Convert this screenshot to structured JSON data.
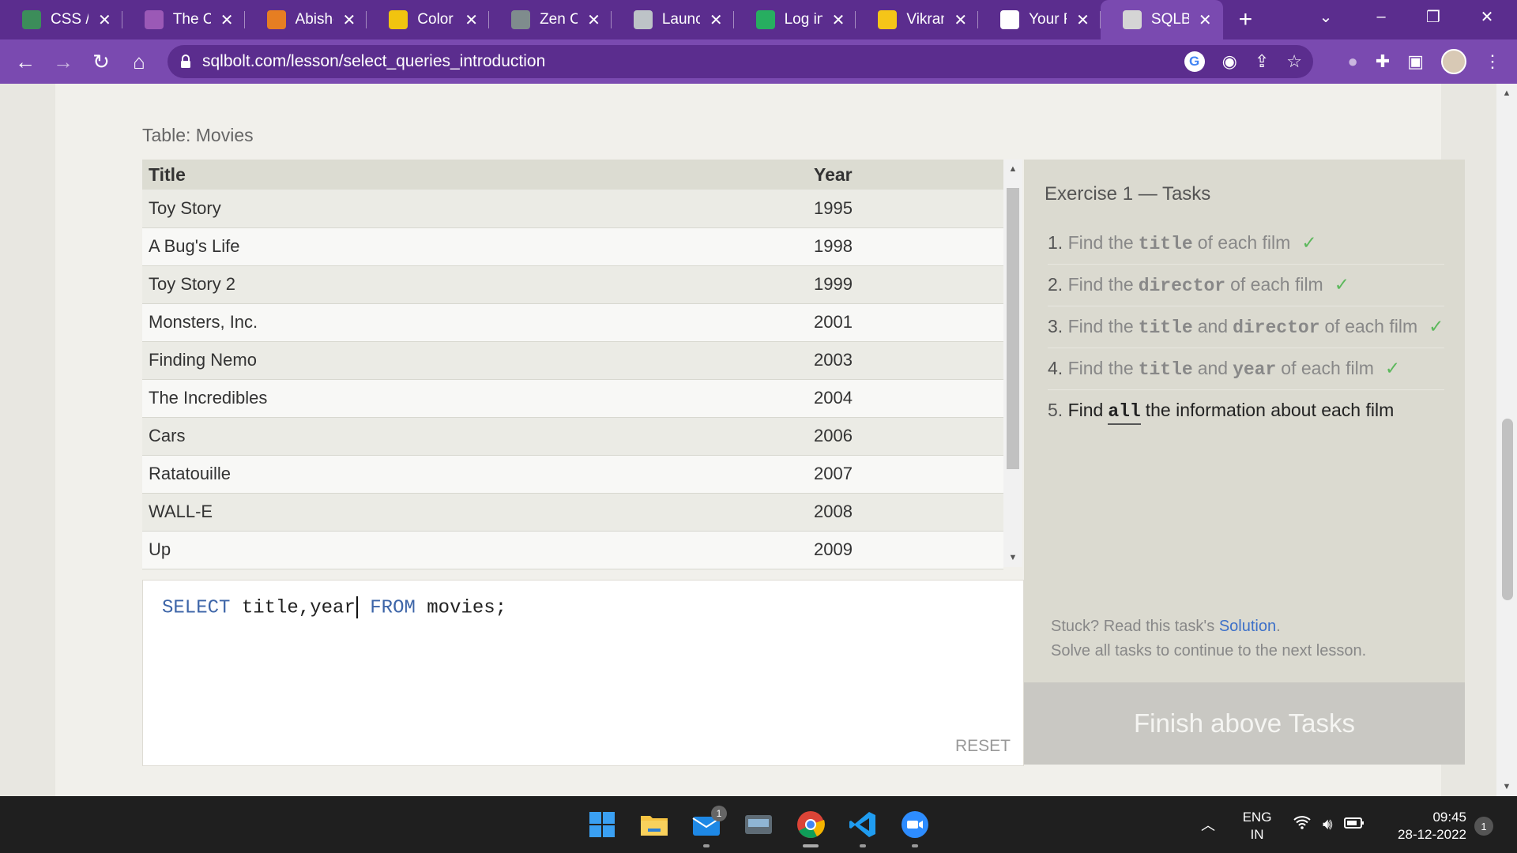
{
  "browser": {
    "tabs": [
      {
        "label": "CSS / C",
        "icon": "google-classroom-icon",
        "color": "#3c8d5a"
      },
      {
        "label": "The Co",
        "icon": "mouse-icon",
        "color": "#9b59b6"
      },
      {
        "label": "Abishe",
        "icon": "a-logo-icon",
        "color": "#e67e22"
      },
      {
        "label": "Color F",
        "icon": "paint-bucket-icon",
        "color": "#f1c40f"
      },
      {
        "label": "Zen Cl",
        "icon": "window-icon",
        "color": "#7f8c8d"
      },
      {
        "label": "Launch",
        "icon": "globe-icon",
        "color": "#bdc3c7"
      },
      {
        "label": "Log in",
        "icon": "mongodb-leaf-icon",
        "color": "#27ae60"
      },
      {
        "label": "Vikram",
        "icon": "imdb-icon",
        "color": "#f5c518"
      },
      {
        "label": "Your R",
        "icon": "github-icon",
        "color": "#ffffff"
      },
      {
        "label": "SQLBo",
        "icon": "database-icon",
        "color": "#d5d5d5",
        "active": true
      }
    ],
    "new_tab": "+",
    "url": "sqlbolt.com/lesson/select_queries_introduction"
  },
  "lesson": {
    "table_caption": "Table: Movies",
    "columns": [
      "Title",
      "Year"
    ],
    "rows": [
      {
        "title": "Toy Story",
        "year": "1995"
      },
      {
        "title": "A Bug's Life",
        "year": "1998"
      },
      {
        "title": "Toy Story 2",
        "year": "1999"
      },
      {
        "title": "Monsters, Inc.",
        "year": "2001"
      },
      {
        "title": "Finding Nemo",
        "year": "2003"
      },
      {
        "title": "The Incredibles",
        "year": "2004"
      },
      {
        "title": "Cars",
        "year": "2006"
      },
      {
        "title": "Ratatouille",
        "year": "2007"
      },
      {
        "title": "WALL-E",
        "year": "2008"
      },
      {
        "title": "Up",
        "year": "2009"
      }
    ],
    "query": {
      "kw1": "SELECT",
      "cols_before_caret": " title,year",
      "kw2": "FROM",
      "rest": " movies;"
    },
    "reset_label": "RESET",
    "tasks_title": "Exercise 1 — Tasks",
    "tasks": [
      {
        "num": "1.",
        "parts": [
          "Find the",
          "title",
          "of each film"
        ],
        "done": true
      },
      {
        "num": "2.",
        "parts": [
          "Find the",
          "director",
          "of each film"
        ],
        "done": true
      },
      {
        "num": "3.",
        "parts": [
          "Find the",
          "title",
          "and",
          "director",
          "of each film"
        ],
        "done": true
      },
      {
        "num": "4.",
        "parts": [
          "Find the",
          "title",
          "and",
          "year",
          "of each film"
        ],
        "done": true
      },
      {
        "num": "5.",
        "parts": [
          "Find",
          "all",
          "the information about each film"
        ],
        "done": false
      }
    ],
    "check_mark": "✓",
    "help_prefix": "Stuck? Read this task's",
    "help_link": "Solution",
    "help_suffix": ".",
    "help_line2": "Solve all tasks to continue to the next lesson.",
    "finish_label": "Finish above Tasks"
  },
  "taskbar": {
    "apps": [
      "windows-start-icon",
      "file-explorer-icon",
      "mail-icon",
      "keyboard-app-icon",
      "chrome-icon",
      "vscode-icon",
      "zoom-icon"
    ],
    "mail_badge": "1",
    "lang_1": "ENG",
    "lang_2": "IN",
    "time": "09:45",
    "date": "28-12-2022",
    "notifications": "1"
  }
}
